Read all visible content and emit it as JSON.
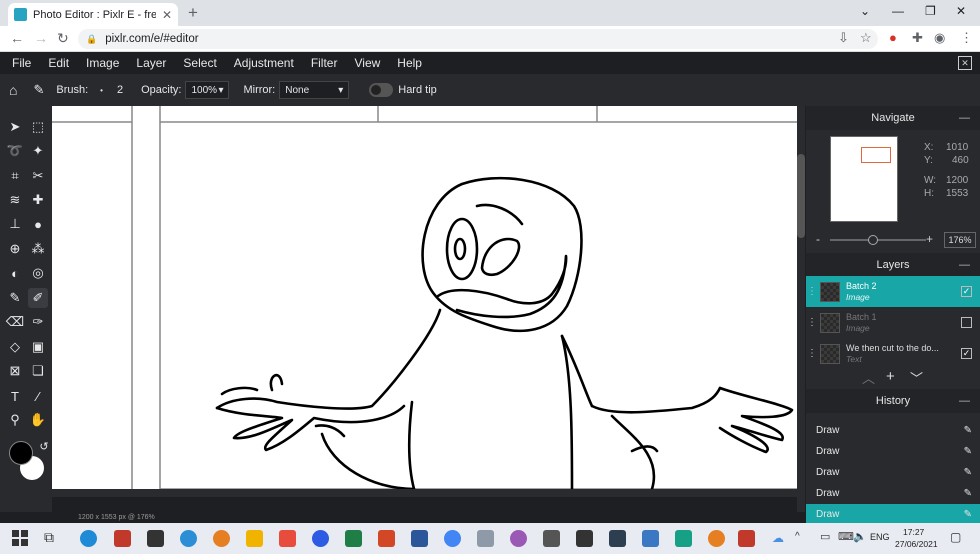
{
  "browser": {
    "tab_title": "Photo Editor : Pixlr E - free image",
    "url": "pixlr.com/e/#editor"
  },
  "menu": [
    "File",
    "Edit",
    "Image",
    "Layer",
    "Select",
    "Adjustment",
    "Filter",
    "View",
    "Help"
  ],
  "options": {
    "brush_label": "Brush:",
    "brush_size": "2",
    "opacity_label": "Opacity:",
    "opacity_value": "100%",
    "mirror_label": "Mirror:",
    "mirror_value": "None",
    "hard_tip_label": "Hard tip"
  },
  "status": "1200 x 1553 px @ 176%",
  "navigate": {
    "title": "Navigate",
    "x_label": "X:",
    "x": "1010",
    "y_label": "Y:",
    "y": "460",
    "w_label": "W:",
    "w": "1200",
    "h_label": "H:",
    "h": "1553",
    "zoom": "176%"
  },
  "layers": {
    "title": "Layers",
    "items": [
      {
        "name": "Batch 2",
        "type": "Image",
        "visible": true,
        "selected": true
      },
      {
        "name": "Batch 1",
        "type": "Image",
        "visible": false,
        "selected": false
      },
      {
        "name": "We then cut to the do...",
        "type": "Text",
        "visible": true,
        "selected": false
      }
    ]
  },
  "history": {
    "title": "History",
    "items": [
      "Draw",
      "Draw",
      "Draw",
      "Draw",
      "Draw"
    ]
  },
  "taskbar": {
    "lang": "ENG",
    "time": "17:27",
    "date": "27/06/2021"
  },
  "colors": {
    "accent": "#19a6a6",
    "foreground": "#000000",
    "background": "#ffffff"
  }
}
